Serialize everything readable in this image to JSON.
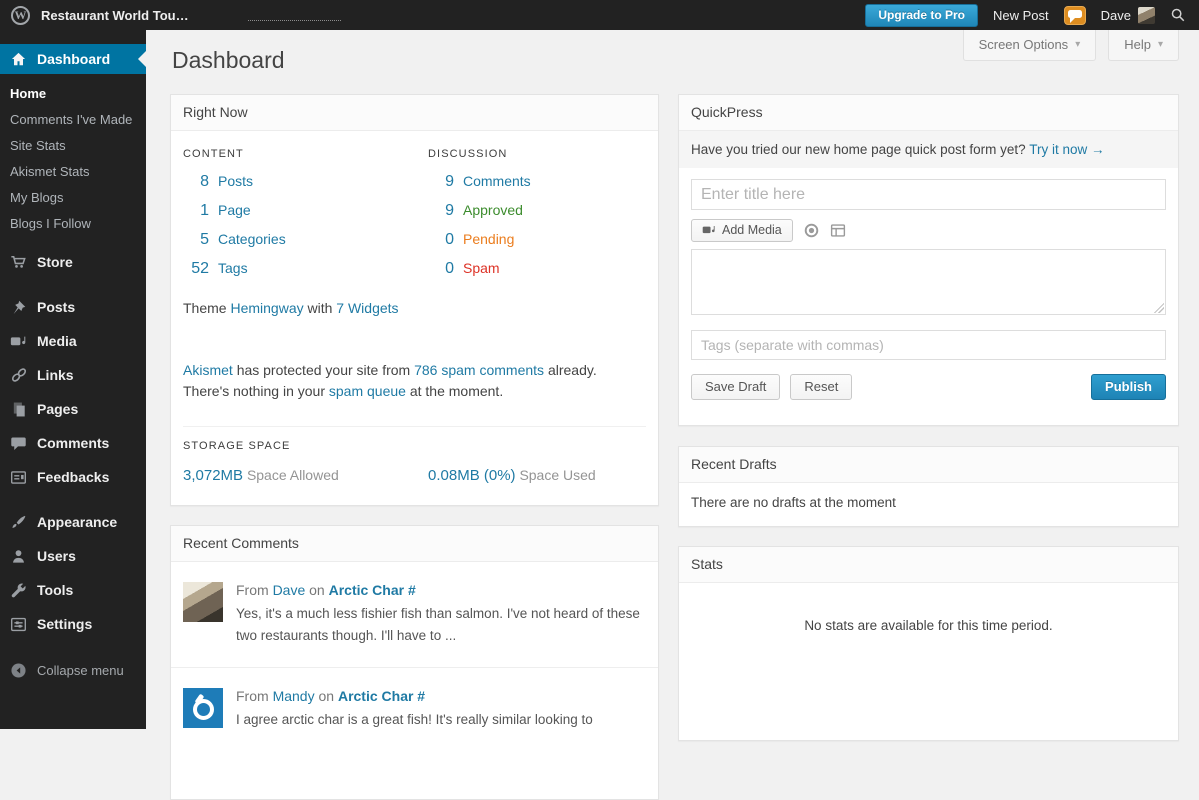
{
  "admin_bar": {
    "site_title": "Restaurant World Tou…",
    "upgrade_button_label": "Upgrade to Pro",
    "new_post_label": "New Post",
    "user_name": "Dave"
  },
  "screen_meta": {
    "screen_options_label": "Screen Options",
    "help_label": "Help",
    "caret": "▾"
  },
  "page": {
    "title": "Dashboard"
  },
  "sidebar": {
    "dashboard_label": "Dashboard",
    "submenu": [
      "Home",
      "Comments I've Made",
      "Site Stats",
      "Akismet Stats",
      "My Blogs",
      "Blogs I Follow"
    ],
    "store_label": "Store",
    "menu": [
      "Posts",
      "Media",
      "Links",
      "Pages",
      "Comments",
      "Feedbacks",
      "Appearance",
      "Users",
      "Tools",
      "Settings"
    ],
    "collapse_label": "Collapse menu"
  },
  "right_now": {
    "title": "Right Now",
    "content_header": "CONTENT",
    "discussion_header": "DISCUSSION",
    "content_rows": [
      {
        "num": "8",
        "label": "Posts"
      },
      {
        "num": "1",
        "label": "Page"
      },
      {
        "num": "5",
        "label": "Categories"
      },
      {
        "num": "52",
        "label": "Tags"
      }
    ],
    "discussion_rows": [
      {
        "num": "9",
        "label": "Comments",
        "color": "#1f7aa4"
      },
      {
        "num": "9",
        "label": "Approved",
        "color": "#3c8c2d"
      },
      {
        "num": "0",
        "label": "Pending",
        "color": "#eb7d1e"
      },
      {
        "num": "0",
        "label": "Spam",
        "color": "#dd3226"
      }
    ],
    "theme_line": {
      "prefix": "Theme",
      "theme_link": "Hemingway",
      "middle": "with",
      "widgets_link": "7 Widgets"
    },
    "akismet": {
      "link_akismet": "Akismet",
      "text_1": "has protected your site from",
      "link_spam_comments": "786 spam comments",
      "text_2": "already.",
      "text_3": "There's nothing in your",
      "link_spam_queue": "spam queue",
      "text_4": "at the moment."
    },
    "storage_header": "STORAGE SPACE",
    "storage_allowed_value": "3,072MB",
    "storage_allowed_label": "Space Allowed",
    "storage_used_value": "0.08MB (0%)",
    "storage_used_label": "Space Used"
  },
  "recent_comments": {
    "title": "Recent Comments",
    "comments": [
      {
        "from": "From",
        "author": "Dave",
        "on": "on",
        "post": "Arctic Char #",
        "text": "Yes, it's a much less fishier fish than salmon. I've not heard of these two restaurants though. I'll have to ..."
      },
      {
        "from": "From",
        "author": "Mandy",
        "on": "on",
        "post": "Arctic Char #",
        "text": "I agree arctic char is a great fish! It's really similar looking to"
      }
    ]
  },
  "quickpress": {
    "title": "QuickPress",
    "notice_text": "Have you tried our new home page quick post form yet?",
    "notice_link": "Try it now →",
    "title_placeholder": "Enter title here",
    "add_media_label": "Add Media",
    "tags_placeholder": "Tags (separate with commas)",
    "save_draft_label": "Save Draft",
    "reset_label": "Reset",
    "publish_label": "Publish"
  },
  "recent_drafts": {
    "title": "Recent Drafts",
    "empty_message": "There are no drafts at the moment"
  },
  "stats_box": {
    "title": "Stats",
    "empty_message": "No stats are available for this time period."
  },
  "icons": {
    "wordpress-logo": "W",
    "search-icon": "magnifier",
    "notifications-icon": "orange-speech-bubble",
    "home-icon": "house",
    "store-icon": "shopping-cart",
    "posts-icon": "pushpin",
    "media-icon": "camera-note",
    "links-icon": "chain",
    "pages-icon": "stacked-pages",
    "comments-icon": "speech-bubble",
    "feedbacks-icon": "form-lines",
    "appearance-icon": "paintbrush",
    "users-icon": "person",
    "tools-icon": "wrench",
    "settings-icon": "sliders-box",
    "collapse-icon": "circle-arrow-left",
    "proofread-icon": "circle-ring",
    "kitchen-sink-icon": "table-grid",
    "dropdown-caret": "▾"
  },
  "colors": {
    "admin_bar_bg": "#222222",
    "sidebar_bg": "#222222",
    "active_menu_blue": "#0074a2",
    "link_blue": "#1f7aa4",
    "approved_green": "#3c8c2d",
    "pending_orange": "#eb7d1e",
    "spam_red": "#dd3226",
    "primary_button_blue": "#1e83b5",
    "upgrade_button_blue": "#2a97c8",
    "notification_orange": "#dd8d21",
    "content_bg": "#f1f1f1"
  }
}
